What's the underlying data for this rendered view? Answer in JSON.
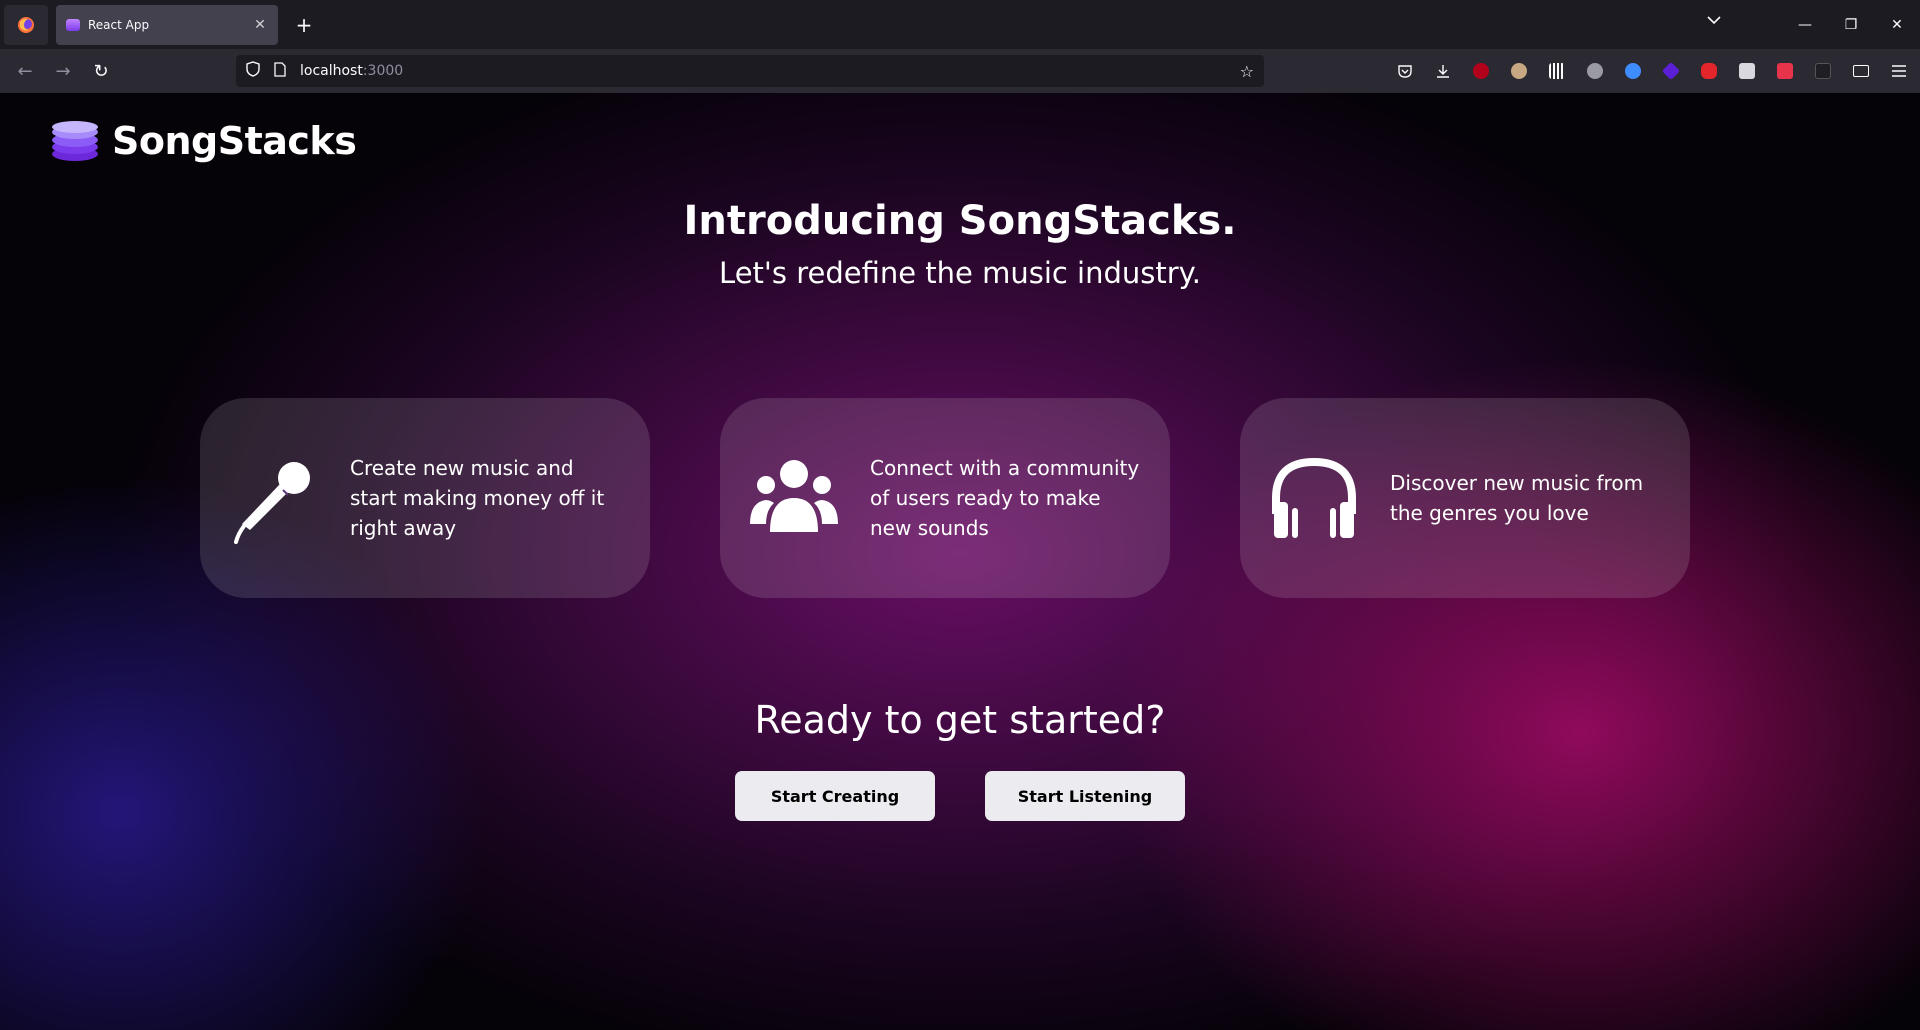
{
  "browser": {
    "tab_title": "React App",
    "url_host": "localhost",
    "url_port": ":3000",
    "extension_icons": [
      "pocket-icon",
      "download-icon",
      "ublock-icon",
      "extension-a-icon",
      "extension-b-icon",
      "extension-c-icon",
      "extension-d-icon",
      "extension-e-icon",
      "extension-f-icon",
      "extension-g-icon",
      "extension-h-icon",
      "extension-i-icon",
      "extension-j-icon",
      "reader-icon",
      "menu-icon"
    ]
  },
  "page": {
    "brand": "SongStacks",
    "hero_title": "Introducing SongStacks.",
    "hero_subtitle": "Let's redefine the music industry.",
    "features": [
      {
        "icon": "microphone-icon",
        "text": "Create new music and start making money off it right away"
      },
      {
        "icon": "users-icon",
        "text": "Connect with a community of users ready to make new sounds"
      },
      {
        "icon": "headphones-icon",
        "text": "Discover new music from the genres you love"
      }
    ],
    "cta_title": "Ready to get started?",
    "cta_primary": "Start Creating",
    "cta_secondary": "Start Listening"
  },
  "colors": {
    "brand_purple": "#8b3dff",
    "button_bg": "#ecebf0"
  }
}
